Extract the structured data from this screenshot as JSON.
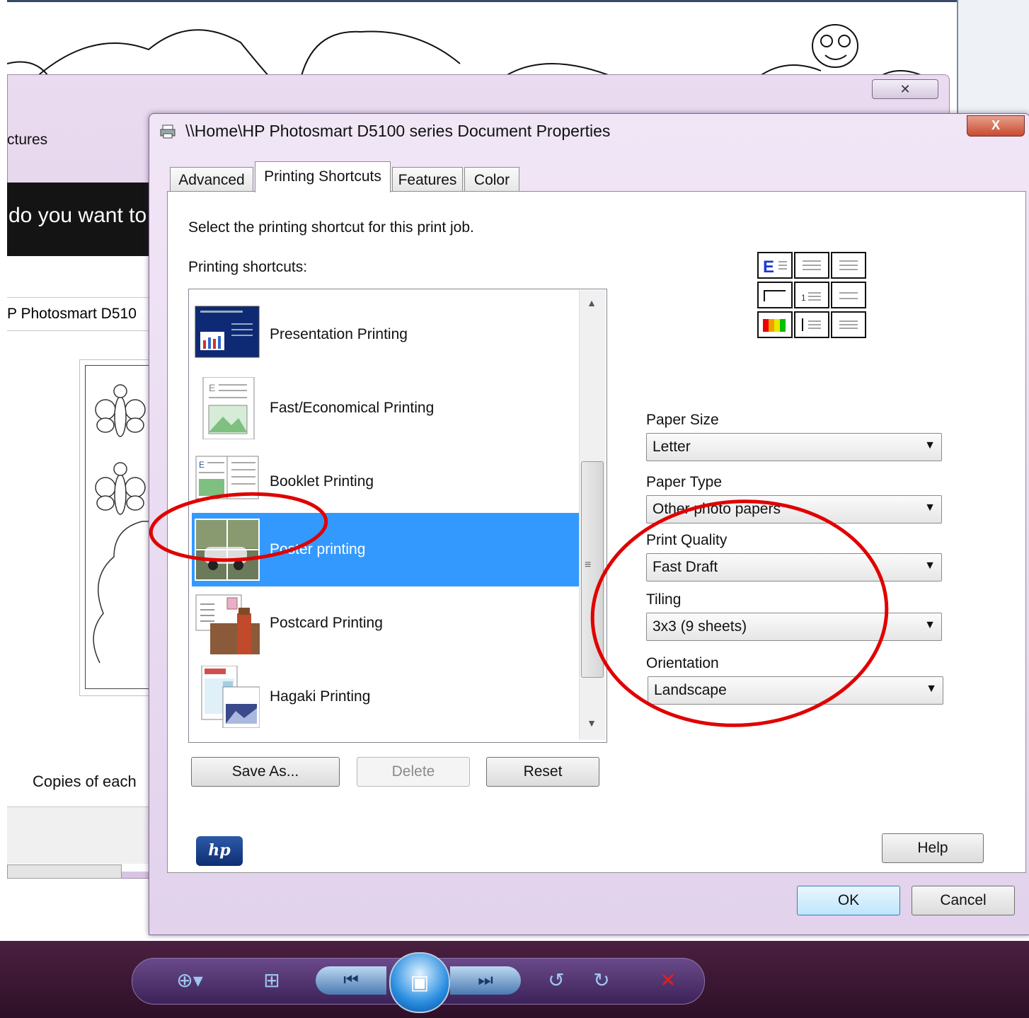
{
  "background_window": {
    "title_fragment": "ctures",
    "prompt_fragment": "do you want to",
    "printer_fragment": "P Photosmart D510",
    "copies_fragment": "Copies of each",
    "close_glyph": "✕"
  },
  "dialog": {
    "title": "\\\\Home\\HP Photosmart D5100 series Document Properties",
    "close_glyph": "X",
    "tabs": [
      {
        "label": "Advanced"
      },
      {
        "label": "Printing Shortcuts",
        "active": true
      },
      {
        "label": "Features"
      },
      {
        "label": "Color"
      }
    ],
    "instruction": "Select the printing shortcut for this print job.",
    "shortcuts_label": "Printing shortcuts:",
    "shortcuts": [
      {
        "label": "Presentation Printing",
        "icon": "presentation-thumb"
      },
      {
        "label": "Fast/Economical Printing",
        "icon": "economical-thumb"
      },
      {
        "label": "Booklet Printing",
        "icon": "booklet-thumb"
      },
      {
        "label": "Poster printing",
        "icon": "poster-thumb",
        "selected": true
      },
      {
        "label": "Postcard Printing",
        "icon": "postcard-thumb"
      },
      {
        "label": "Hagaki Printing",
        "icon": "hagaki-thumb"
      }
    ],
    "scroll_up_glyph": "▲",
    "scroll_down_glyph": "▼",
    "scroll_grip_glyph": "≡",
    "buttons": {
      "save_as": "Save As...",
      "delete": "Delete",
      "reset": "Reset",
      "help": "Help",
      "ok": "OK",
      "cancel": "Cancel"
    },
    "fields": {
      "paper_size": {
        "label": "Paper Size",
        "value": "Letter"
      },
      "paper_type": {
        "label": "Paper Type",
        "value": "Other photo papers"
      },
      "print_quality": {
        "label": "Print Quality",
        "value": "Fast Draft"
      },
      "tiling": {
        "label": "Tiling",
        "value": "3x3 (9 sheets)"
      },
      "orientation": {
        "label": "Orientation",
        "value": "Landscape"
      }
    },
    "dropdown_arrow": "▼",
    "logo_text": "hp"
  },
  "taskbar": {
    "zoom_glyph": "⊕▾",
    "actual_size_glyph": "⊞",
    "prev_glyph": "⏮",
    "next_glyph": "⏭",
    "slideshow_glyph": "▣",
    "rotate_ccw_glyph": "↺",
    "rotate_cw_glyph": "↻",
    "delete_glyph": "✕"
  },
  "colors": {
    "selection": "#3399ff",
    "annotation_red": "#e00000",
    "dialog_frame": "#e6d6ee",
    "taskbar": "#3a1634"
  }
}
